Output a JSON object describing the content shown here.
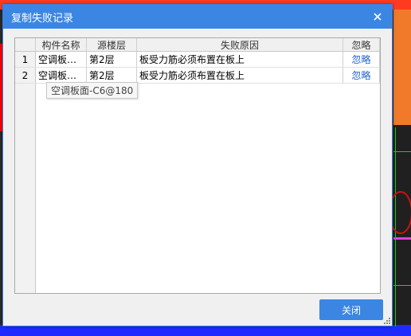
{
  "dialog": {
    "title": "复制失败记录",
    "close_label": "关闭"
  },
  "table": {
    "columns": [
      "构件名称",
      "源楼层",
      "失败原因",
      "忽略"
    ],
    "rows": [
      {
        "index": "1",
        "name": "空调板…",
        "floor": "第2层",
        "reason": "板受力筋必须布置在板上",
        "action": "忽略"
      },
      {
        "index": "2",
        "name": "空调板…",
        "floor": "第2层",
        "reason": "板受力筋必须布置在板上",
        "action": "忽略"
      }
    ]
  },
  "tooltip": {
    "text": "空调板面-C6@180"
  },
  "icons": {
    "close": "close-icon",
    "resize": "resize-grip-icon"
  },
  "colors": {
    "accent": "#3b86e3",
    "link": "#1a5fd0"
  }
}
